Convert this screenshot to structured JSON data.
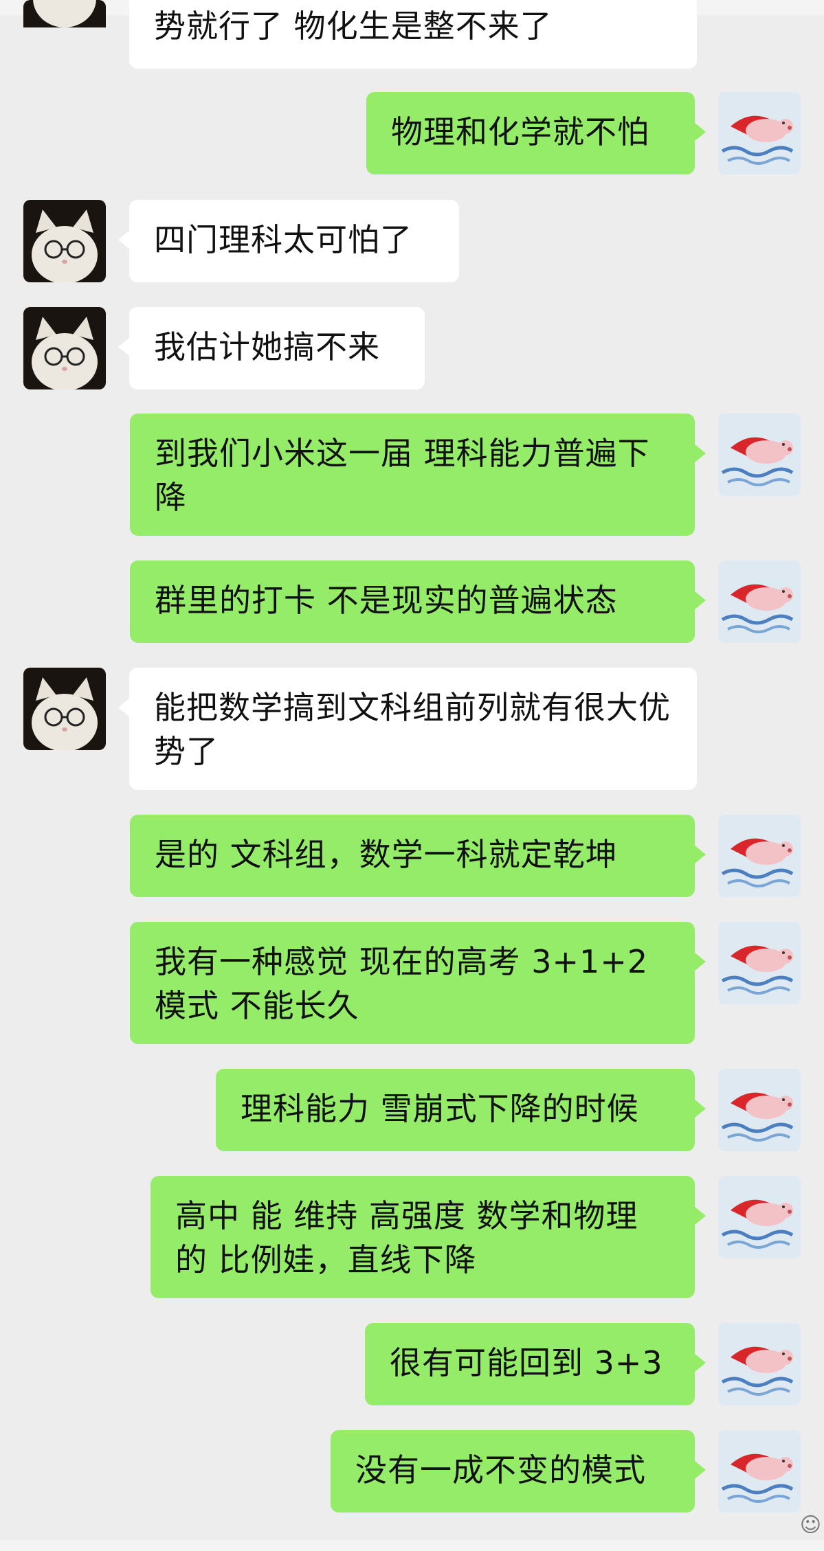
{
  "chat": {
    "messages": [
      {
        "side": "left",
        "text": "势就行了 物化生是整不来了"
      },
      {
        "side": "right",
        "text": "物理和化学就不怕"
      },
      {
        "side": "left",
        "text": "四门理科太可怕了"
      },
      {
        "side": "left",
        "text": "我估计她搞不来"
      },
      {
        "side": "right",
        "text": "到我们小米这一届 理科能力普遍下降"
      },
      {
        "side": "right",
        "text": "群里的打卡 不是现实的普遍状态"
      },
      {
        "side": "left",
        "text": "能把数学搞到文科组前列就有很大优势了"
      },
      {
        "side": "right",
        "text": "是的 文科组，数学一科就定乾坤"
      },
      {
        "side": "right",
        "text": "我有一种感觉 现在的高考 3+1+2 模式 不能长久"
      },
      {
        "side": "right",
        "text": "理科能力 雪崩式下降的时候"
      },
      {
        "side": "right",
        "text": "高中 能 维持 高强度 数学和物理的 比例娃，直线下降"
      },
      {
        "side": "right",
        "text": "很有可能回到 3+3"
      },
      {
        "side": "right",
        "text": "没有一成不变的模式"
      }
    ]
  },
  "avatars": {
    "left_icon": "white-cat-with-glasses-avatar",
    "right_icon": "flying-pig-with-red-cape-avatar"
  },
  "colors": {
    "background": "#ededed",
    "incoming_bubble": "#ffffff",
    "outgoing_bubble": "#95ec69",
    "text": "#111111"
  },
  "ui": {
    "side_glyph": "☺"
  }
}
